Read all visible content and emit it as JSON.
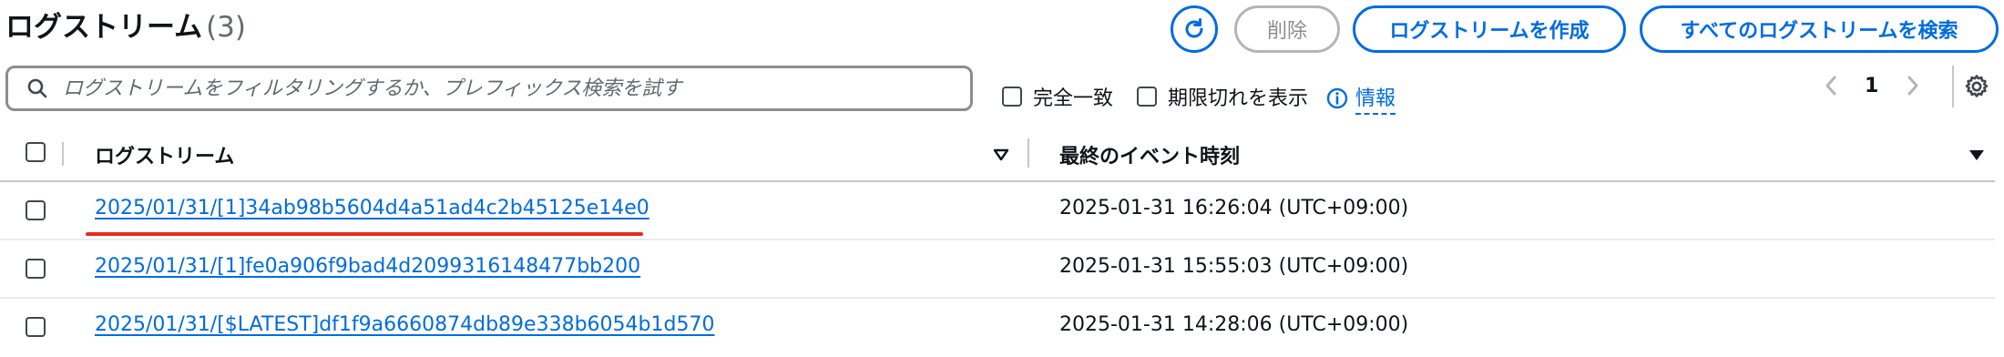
{
  "header": {
    "title": "ログストリーム",
    "count": "(3)",
    "delete_label": "削除",
    "create_label": "ログストリームを作成",
    "search_all_label": "すべてのログストリームを検索"
  },
  "filter": {
    "placeholder": "ログストリームをフィルタリングするか、プレフィックス検索を試す",
    "value": "",
    "exact_match_label": "完全一致",
    "show_expired_label": "期限切れを表示",
    "info_label": "情報"
  },
  "pagination": {
    "current_page": "1"
  },
  "table": {
    "columns": [
      "ログストリーム",
      "最終のイベント時刻"
    ],
    "rows": [
      {
        "stream": "2025/01/31/[1]34ab98b5604d4a51ad4c2b45125e14e0",
        "last_event": "2025-01-31 16:26:04 (UTC+09:00)"
      },
      {
        "stream": "2025/01/31/[1]fe0a906f9bad4d2099316148477bb200",
        "last_event": "2025-01-31 15:55:03 (UTC+09:00)"
      },
      {
        "stream": "2025/01/31/[$LATEST]df1f9a6660874db89e338b6054b1d570",
        "last_event": "2025-01-31 14:28:06 (UTC+09:00)"
      }
    ]
  },
  "colors": {
    "accent": "#006ce0",
    "highlight_underline": "#e52b1e",
    "text": "#0f141a",
    "border": "#c6c6cd"
  },
  "icons": [
    "refresh-icon",
    "search-icon",
    "info-icon",
    "chevron-left-icon",
    "chevron-right-icon",
    "gear-icon",
    "sort-down-icon",
    "sort-desc-icon"
  ]
}
